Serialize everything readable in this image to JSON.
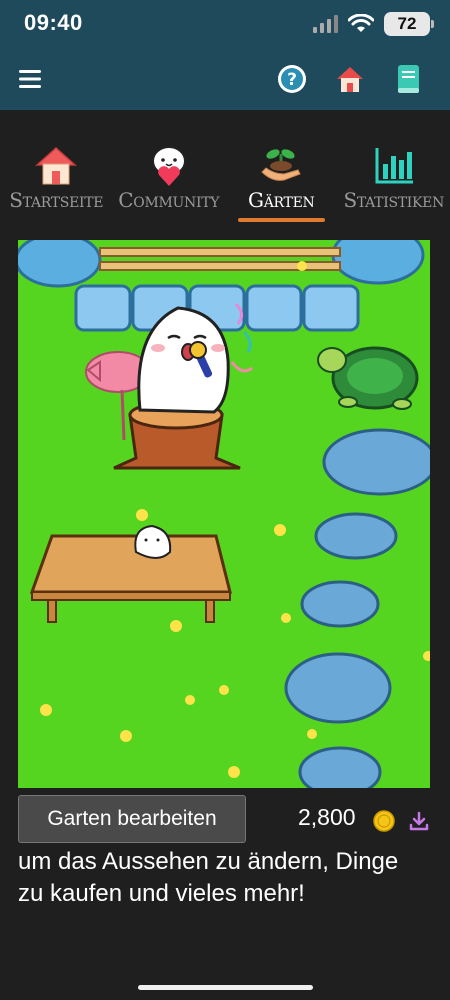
{
  "status_bar": {
    "time": "09:40",
    "battery": "72",
    "icons": [
      "signal-icon",
      "wifi-icon",
      "battery-icon"
    ]
  },
  "app_bar": {
    "icons": [
      "menu-icon",
      "help-icon",
      "home-icon",
      "book-icon"
    ],
    "background": "#1e4a5b"
  },
  "tabs": [
    {
      "label": "Startseite",
      "icon": "house-icon",
      "active": false
    },
    {
      "label": "Community",
      "icon": "mascot-heart-icon",
      "active": false
    },
    {
      "label": "Gärten",
      "icon": "plant-hand-icon",
      "active": true
    },
    {
      "label": "Statistiken",
      "icon": "bar-chart-icon",
      "active": false
    }
  ],
  "accent_color": "#e07a2e",
  "garden": {
    "description": "Garden illustration",
    "grass_color": "#55d51f"
  },
  "footer": {
    "edit_button_label": "Garten bearbeiten",
    "coins": "2,800",
    "coin_icon": "coin-icon",
    "download_icon": "download-icon",
    "description": "um das Aussehen zu ändern, Dinge zu kaufen und vieles mehr!"
  }
}
